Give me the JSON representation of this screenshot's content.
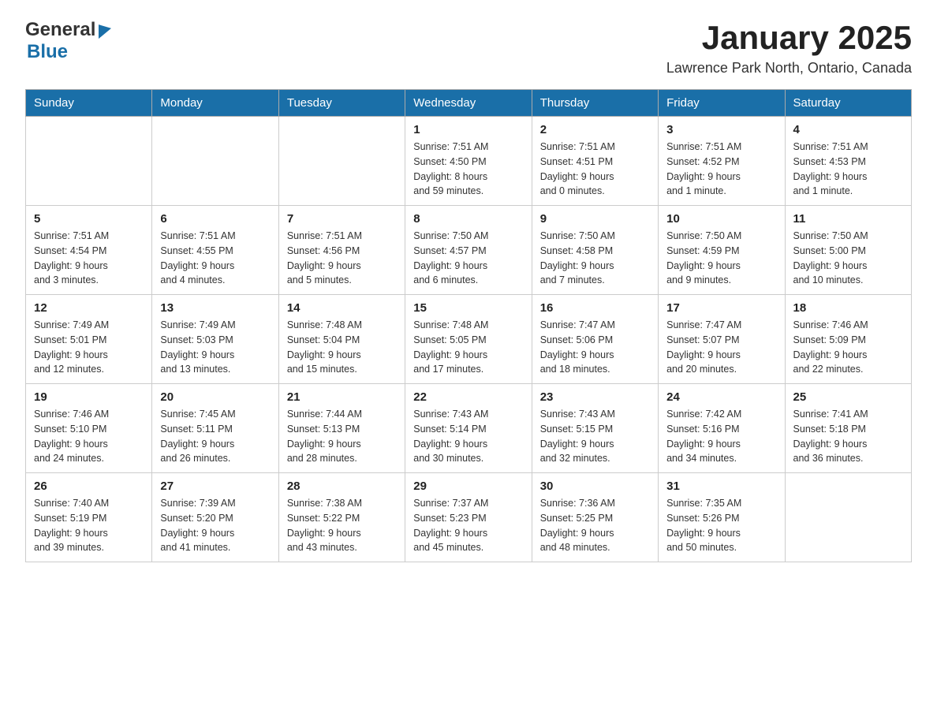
{
  "header": {
    "logo_general": "General",
    "logo_blue": "Blue",
    "month": "January 2025",
    "location": "Lawrence Park North, Ontario, Canada"
  },
  "weekdays": [
    "Sunday",
    "Monday",
    "Tuesday",
    "Wednesday",
    "Thursday",
    "Friday",
    "Saturday"
  ],
  "weeks": [
    [
      {
        "day": "",
        "info": ""
      },
      {
        "day": "",
        "info": ""
      },
      {
        "day": "",
        "info": ""
      },
      {
        "day": "1",
        "info": "Sunrise: 7:51 AM\nSunset: 4:50 PM\nDaylight: 8 hours\nand 59 minutes."
      },
      {
        "day": "2",
        "info": "Sunrise: 7:51 AM\nSunset: 4:51 PM\nDaylight: 9 hours\nand 0 minutes."
      },
      {
        "day": "3",
        "info": "Sunrise: 7:51 AM\nSunset: 4:52 PM\nDaylight: 9 hours\nand 1 minute."
      },
      {
        "day": "4",
        "info": "Sunrise: 7:51 AM\nSunset: 4:53 PM\nDaylight: 9 hours\nand 1 minute."
      }
    ],
    [
      {
        "day": "5",
        "info": "Sunrise: 7:51 AM\nSunset: 4:54 PM\nDaylight: 9 hours\nand 3 minutes."
      },
      {
        "day": "6",
        "info": "Sunrise: 7:51 AM\nSunset: 4:55 PM\nDaylight: 9 hours\nand 4 minutes."
      },
      {
        "day": "7",
        "info": "Sunrise: 7:51 AM\nSunset: 4:56 PM\nDaylight: 9 hours\nand 5 minutes."
      },
      {
        "day": "8",
        "info": "Sunrise: 7:50 AM\nSunset: 4:57 PM\nDaylight: 9 hours\nand 6 minutes."
      },
      {
        "day": "9",
        "info": "Sunrise: 7:50 AM\nSunset: 4:58 PM\nDaylight: 9 hours\nand 7 minutes."
      },
      {
        "day": "10",
        "info": "Sunrise: 7:50 AM\nSunset: 4:59 PM\nDaylight: 9 hours\nand 9 minutes."
      },
      {
        "day": "11",
        "info": "Sunrise: 7:50 AM\nSunset: 5:00 PM\nDaylight: 9 hours\nand 10 minutes."
      }
    ],
    [
      {
        "day": "12",
        "info": "Sunrise: 7:49 AM\nSunset: 5:01 PM\nDaylight: 9 hours\nand 12 minutes."
      },
      {
        "day": "13",
        "info": "Sunrise: 7:49 AM\nSunset: 5:03 PM\nDaylight: 9 hours\nand 13 minutes."
      },
      {
        "day": "14",
        "info": "Sunrise: 7:48 AM\nSunset: 5:04 PM\nDaylight: 9 hours\nand 15 minutes."
      },
      {
        "day": "15",
        "info": "Sunrise: 7:48 AM\nSunset: 5:05 PM\nDaylight: 9 hours\nand 17 minutes."
      },
      {
        "day": "16",
        "info": "Sunrise: 7:47 AM\nSunset: 5:06 PM\nDaylight: 9 hours\nand 18 minutes."
      },
      {
        "day": "17",
        "info": "Sunrise: 7:47 AM\nSunset: 5:07 PM\nDaylight: 9 hours\nand 20 minutes."
      },
      {
        "day": "18",
        "info": "Sunrise: 7:46 AM\nSunset: 5:09 PM\nDaylight: 9 hours\nand 22 minutes."
      }
    ],
    [
      {
        "day": "19",
        "info": "Sunrise: 7:46 AM\nSunset: 5:10 PM\nDaylight: 9 hours\nand 24 minutes."
      },
      {
        "day": "20",
        "info": "Sunrise: 7:45 AM\nSunset: 5:11 PM\nDaylight: 9 hours\nand 26 minutes."
      },
      {
        "day": "21",
        "info": "Sunrise: 7:44 AM\nSunset: 5:13 PM\nDaylight: 9 hours\nand 28 minutes."
      },
      {
        "day": "22",
        "info": "Sunrise: 7:43 AM\nSunset: 5:14 PM\nDaylight: 9 hours\nand 30 minutes."
      },
      {
        "day": "23",
        "info": "Sunrise: 7:43 AM\nSunset: 5:15 PM\nDaylight: 9 hours\nand 32 minutes."
      },
      {
        "day": "24",
        "info": "Sunrise: 7:42 AM\nSunset: 5:16 PM\nDaylight: 9 hours\nand 34 minutes."
      },
      {
        "day": "25",
        "info": "Sunrise: 7:41 AM\nSunset: 5:18 PM\nDaylight: 9 hours\nand 36 minutes."
      }
    ],
    [
      {
        "day": "26",
        "info": "Sunrise: 7:40 AM\nSunset: 5:19 PM\nDaylight: 9 hours\nand 39 minutes."
      },
      {
        "day": "27",
        "info": "Sunrise: 7:39 AM\nSunset: 5:20 PM\nDaylight: 9 hours\nand 41 minutes."
      },
      {
        "day": "28",
        "info": "Sunrise: 7:38 AM\nSunset: 5:22 PM\nDaylight: 9 hours\nand 43 minutes."
      },
      {
        "day": "29",
        "info": "Sunrise: 7:37 AM\nSunset: 5:23 PM\nDaylight: 9 hours\nand 45 minutes."
      },
      {
        "day": "30",
        "info": "Sunrise: 7:36 AM\nSunset: 5:25 PM\nDaylight: 9 hours\nand 48 minutes."
      },
      {
        "day": "31",
        "info": "Sunrise: 7:35 AM\nSunset: 5:26 PM\nDaylight: 9 hours\nand 50 minutes."
      },
      {
        "day": "",
        "info": ""
      }
    ]
  ]
}
